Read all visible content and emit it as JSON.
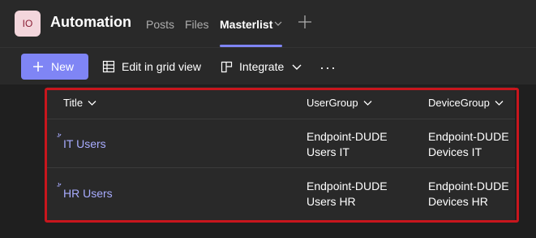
{
  "header": {
    "avatar_text": "IO",
    "app_title": "Automation",
    "tabs": [
      {
        "label": "Posts"
      },
      {
        "label": "Files"
      },
      {
        "label": "Masterlist"
      }
    ]
  },
  "toolbar": {
    "new_label": "New",
    "grid_label": "Edit in grid view",
    "integrate_label": "Integrate",
    "more_label": "···"
  },
  "table": {
    "columns": [
      "Title",
      "UserGroup",
      "DeviceGroup"
    ],
    "rows": [
      {
        "title": "IT Users",
        "usergroup_line1": "Endpoint-DUDE",
        "usergroup_line2": "Users IT",
        "devicegroup_line1": "Endpoint-DUDE",
        "devicegroup_line2": "Devices IT"
      },
      {
        "title": "HR Users",
        "usergroup_line1": "Endpoint-DUDE",
        "usergroup_line2": "Users HR",
        "devicegroup_line1": "Endpoint-DUDE",
        "devicegroup_line2": "Devices HR"
      }
    ]
  },
  "colors": {
    "accent": "#7f85f5",
    "link": "#a8acff",
    "highlight": "#c8161d"
  }
}
